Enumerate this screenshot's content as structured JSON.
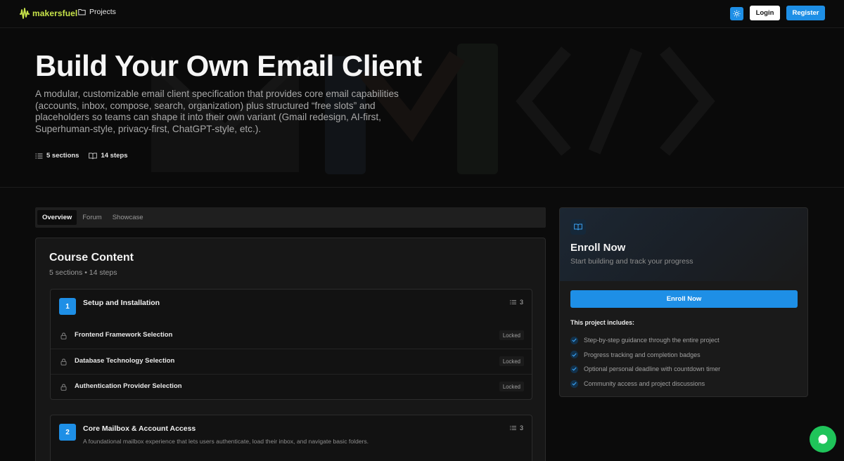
{
  "nav": {
    "logo_text": "makersfuel",
    "projects_label": "Projects",
    "login_label": "Login",
    "register_label": "Register"
  },
  "hero": {
    "title": "Build Your Own Email Client",
    "description": "A modular, customizable email client specification that provides core email capabilities (accounts, inbox, compose, search, organization) plus structured “free slots” and placeholders so teams can shape it into their own variant (Gmail redesign, AI-first, Superhuman-style, privacy-first, ChatGPT-style, etc.).",
    "sections_label": "5 sections",
    "steps_label": "14 steps"
  },
  "tabs": [
    {
      "label": "Overview",
      "active": true
    },
    {
      "label": "Forum",
      "active": false
    },
    {
      "label": "Showcase",
      "active": false
    }
  ],
  "course": {
    "title": "Course Content",
    "subtitle": "5 sections • 14 steps",
    "sections": [
      {
        "number": "1",
        "title": "Setup and Installation",
        "count": "3",
        "steps": [
          {
            "title": "Frontend Framework Selection",
            "status": "Locked"
          },
          {
            "title": "Database Technology Selection",
            "status": "Locked"
          },
          {
            "title": "Authentication Provider Selection",
            "status": "Locked"
          }
        ]
      },
      {
        "number": "2",
        "title": "Core Mailbox & Account Access",
        "description": "A foundational mailbox experience that lets users authenticate, load their inbox, and navigate basic folders.",
        "count": "3"
      }
    ]
  },
  "enroll": {
    "title": "Enroll Now",
    "subtitle": "Start building and track your progress",
    "button_label": "Enroll Now",
    "includes_title": "This project includes:",
    "includes": [
      "Step-by-step guidance through the entire project",
      "Progress tracking and completion badges",
      "Optional personal deadline with countdown timer",
      "Community access and project discussions"
    ]
  },
  "colors": {
    "accent": "#1e8fe6",
    "logo": "#c7e34a",
    "chat": "#1fc45a",
    "background": "#0b0b0b"
  }
}
